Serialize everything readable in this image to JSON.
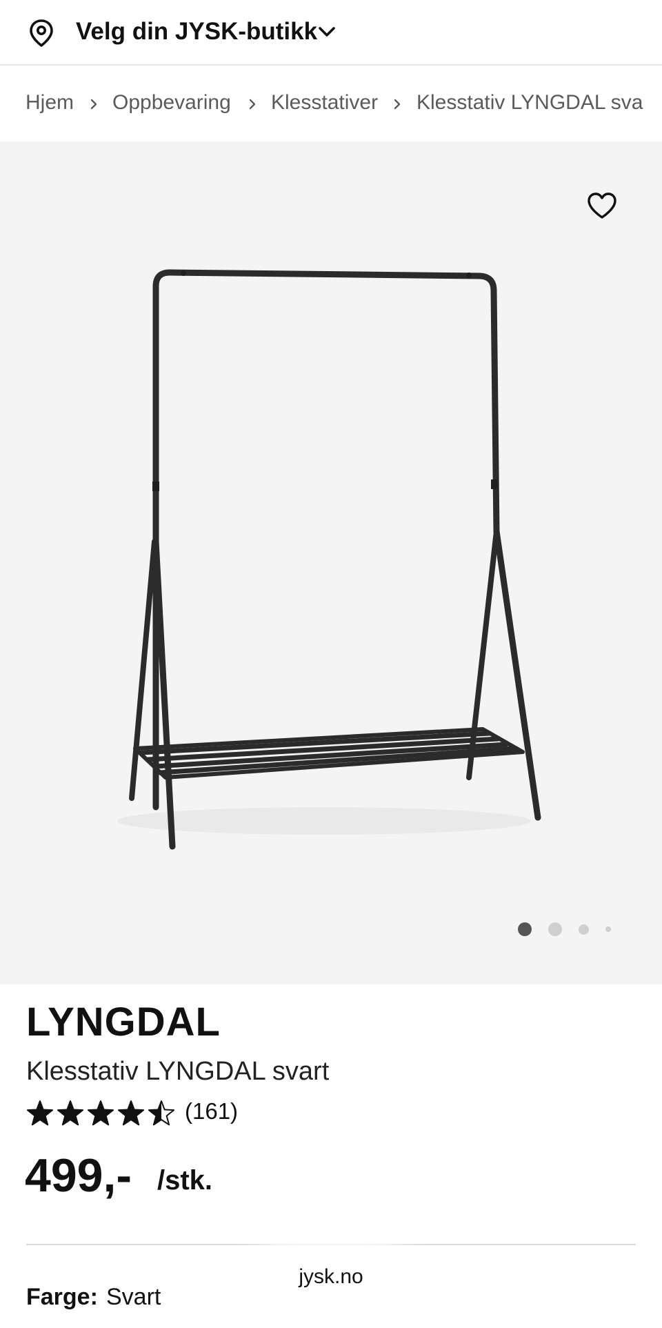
{
  "store_bar": {
    "label": "Velg din JYSK-butikk",
    "icon": "location-pin-icon",
    "dropdown_icon": "chevron-down-icon"
  },
  "breadcrumb": {
    "items": [
      "Hjem",
      "Oppbevaring",
      "Klesstativer",
      "Klesstativ LYNGDAL sva"
    ],
    "separator_icon": "chevron-right-icon"
  },
  "gallery": {
    "favorite_icon": "heart-outline-icon",
    "image": "clothes-rack-product-image",
    "slide_count": 4,
    "active_slide": 1
  },
  "product": {
    "brand": "LYNGDAL",
    "name": "Klesstativ LYNGDAL svart",
    "rating": 4.5,
    "rating_max": 5,
    "review_count": "(161)",
    "price": "499,-",
    "unit": "/stk.",
    "color_label": "Farge:",
    "color_value": "Svart"
  },
  "browser": {
    "url": "jysk.no"
  },
  "colors": {
    "text": "#111111",
    "breadcrumb": "#5a5a5a",
    "gallery_bg": "#f4f4f4",
    "divider": "#dcdcdc",
    "dot_active": "#555555",
    "dot_inactive": "#cfcfcf"
  }
}
